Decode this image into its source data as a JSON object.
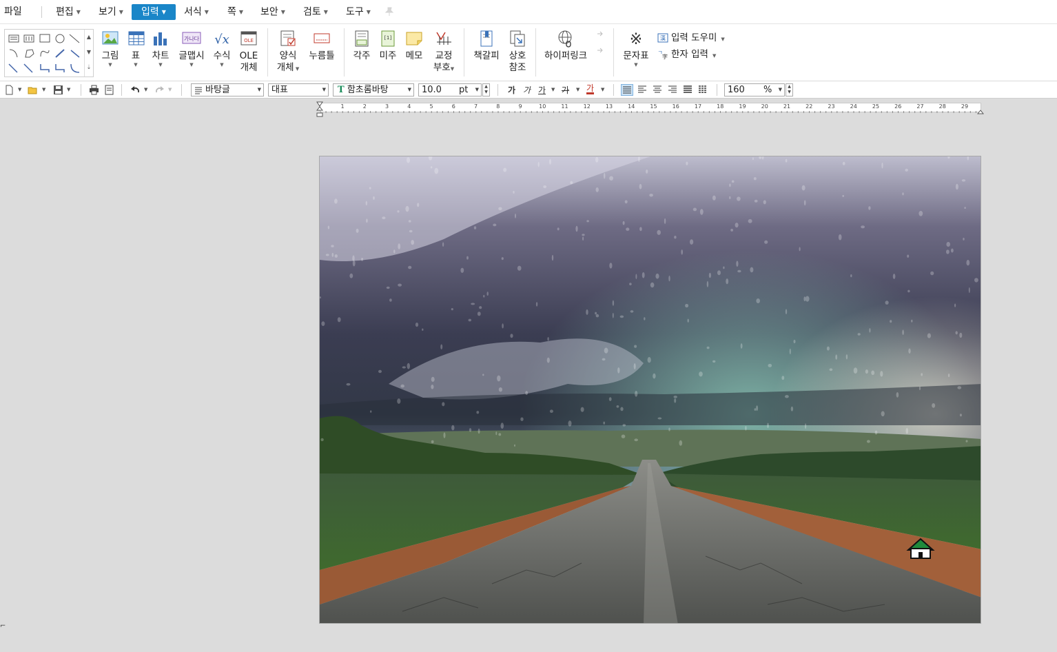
{
  "menu": {
    "items": [
      {
        "label": "파일"
      },
      {
        "label": "편집"
      },
      {
        "label": "보기"
      },
      {
        "label": "입력"
      },
      {
        "label": "서식"
      },
      {
        "label": "쪽"
      },
      {
        "label": "보안"
      },
      {
        "label": "검토"
      },
      {
        "label": "도구"
      }
    ],
    "active": "입력",
    "accent_color": "#1a86c8"
  },
  "ribbon": {
    "picture": "그림",
    "table": "표",
    "chart": "차트",
    "wordart": "글맵시",
    "equation": "수식",
    "ole_line1": "OLE",
    "ole_line2": "개체",
    "form_line1": "양식",
    "form_line2": "개체",
    "button": "누름틀",
    "footnote": "각주",
    "endnote": "미주",
    "memo": "메모",
    "proof_line1": "교정",
    "proof_line2": "부호",
    "bookmark": "책갈피",
    "crossref_line1": "상호",
    "crossref_line2": "참조",
    "hyperlink": "하이퍼링크",
    "charmap": "문자표",
    "input_helper": "입력 도우미",
    "hanja_input": "한자 입력",
    "ole_badge": "OLE",
    "wordart_badge": "가나다"
  },
  "toolbar": {
    "style": "바탕글",
    "language": "대표",
    "font": "함초롬바탕",
    "font_badge": "T",
    "size": "10.0",
    "size_unit": "pt",
    "bold": "가",
    "italic": "가",
    "underline": "가",
    "strike": "가",
    "color": "가",
    "zoom": "160",
    "zoom_unit": "%"
  },
  "ruler": {
    "numbers": [
      "1",
      "2",
      "3",
      "4",
      "5",
      "6",
      "7",
      "8",
      "9",
      "10",
      "11",
      "12",
      "13",
      "14",
      "15",
      "16",
      "17",
      "18",
      "19",
      "20",
      "21",
      "22",
      "23",
      "24",
      "25",
      "26",
      "27",
      "28",
      "29"
    ]
  },
  "document": {
    "image_subject": "storm-clouds-over-rural-road"
  }
}
